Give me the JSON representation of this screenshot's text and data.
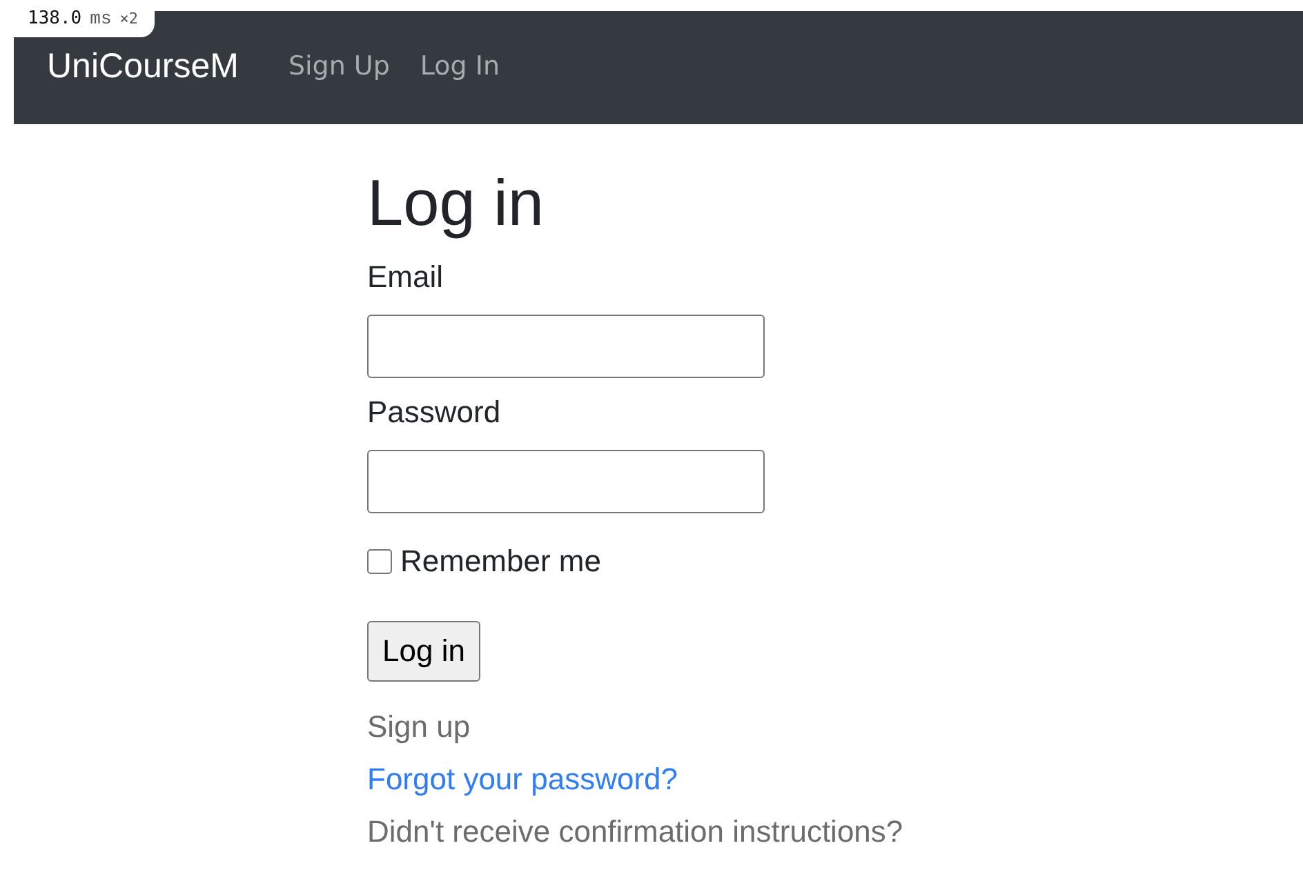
{
  "timing_badge": {
    "value": "138.0",
    "unit": "ms",
    "multiplier": "×2"
  },
  "navbar": {
    "brand": "UniCourseM",
    "links": [
      "Sign Up",
      "Log In"
    ]
  },
  "form": {
    "title": "Log in",
    "fields": [
      {
        "label": "Email"
      },
      {
        "label": "Password"
      }
    ],
    "remember": {
      "label": "Remember me",
      "checked": false
    },
    "submit": "Log in"
  },
  "links": [
    {
      "text": "Sign up",
      "color": "#6c6c6c"
    },
    {
      "text": "Forgot your password?",
      "color": "#2f7ef6"
    },
    {
      "text": "Didn't receive confirmation instructions?",
      "color": "#6c6c6c"
    }
  ]
}
